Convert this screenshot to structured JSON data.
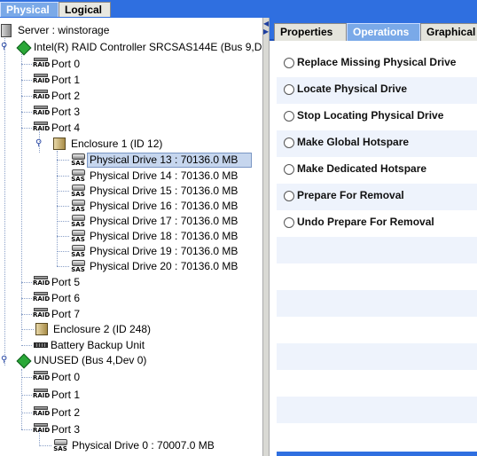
{
  "top_tabs": [
    "Physical",
    "Logical"
  ],
  "tree": {
    "server": "Server : winstorage",
    "controller": "Intel(R) RAID Controller SRCSAS144E (Bus 9,D",
    "ports_a": [
      "Port 0",
      "Port 1",
      "Port 2",
      "Port 3",
      "Port 4"
    ],
    "enclosure1": "Enclosure  1 (ID 12)",
    "drives": [
      "Physical Drive 13 : 70136.0 MB",
      "Physical Drive 14 : 70136.0 MB",
      "Physical Drive 15 : 70136.0 MB",
      "Physical Drive 16 : 70136.0 MB",
      "Physical Drive 17 : 70136.0 MB",
      "Physical Drive 18 : 70136.0 MB",
      "Physical Drive 19 : 70136.0 MB",
      "Physical Drive 20 : 70136.0 MB"
    ],
    "ports_b": [
      "Port 5",
      "Port 6",
      "Port 7"
    ],
    "enclosure2": "Enclosure  2 (ID 248)",
    "battery": "Battery Backup Unit",
    "unused": "UNUSED (Bus 4,Dev 0)",
    "unused_ports": [
      "Port 0",
      "Port 1",
      "Port 2",
      "Port 3"
    ],
    "unused_drive": "Physical Drive 0 : 70007.0 MB",
    "icon_labels": {
      "raid": "RAID",
      "sas": "SAS"
    }
  },
  "right_tabs": [
    "Properties",
    "Operations",
    "Graphical"
  ],
  "operations": [
    "Replace Missing Physical Drive",
    "Locate Physical Drive",
    "Stop Locating Physical Drive",
    "Make Global Hotspare",
    "Make Dedicated Hotspare",
    "Prepare For Removal",
    "Undo Prepare For Removal"
  ],
  "colors": {
    "accent": "#2f6fe0",
    "selected": "#c6d6ee"
  }
}
